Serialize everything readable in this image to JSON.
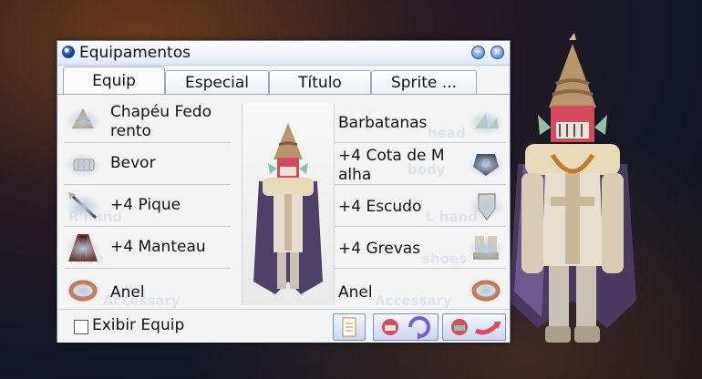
{
  "window": {
    "title": "Equipamentos",
    "minimize_label": "−",
    "close_label": "×",
    "tabs": [
      {
        "label": "Equip",
        "active": true
      },
      {
        "label": "Especial",
        "active": false
      },
      {
        "label": "Título",
        "active": false
      },
      {
        "label": "Sprite ...",
        "active": false
      }
    ]
  },
  "left_slots": [
    {
      "name": "Chapéu Fedo\nrento",
      "ghost": "",
      "icon": "hat-icon"
    },
    {
      "name": "Bevor",
      "ghost": "",
      "icon": "mask-icon"
    },
    {
      "name": "+4 Pique",
      "ghost": "R hand",
      "icon": "spear-icon"
    },
    {
      "name": "+4 Manteau",
      "ghost": "robe",
      "icon": "manteau-icon"
    },
    {
      "name": "Anel",
      "ghost": "Accessary",
      "icon": "ring-icon"
    }
  ],
  "right_slots": [
    {
      "name": "Barbatanas",
      "ghost": "head",
      "icon": "fins-icon"
    },
    {
      "name": "+4 Cota de M\nalha",
      "ghost": "body",
      "icon": "chainmail-icon"
    },
    {
      "name": "+4 Escudo",
      "ghost": "L hand",
      "icon": "shield-icon"
    },
    {
      "name": "+4 Grevas",
      "ghost": "shoes",
      "icon": "greaves-icon"
    },
    {
      "name": "Anel",
      "ghost": "Accessary",
      "icon": "ring-icon"
    }
  ],
  "bottom": {
    "show_equip_label": "Exibir Equip",
    "show_equip_checked": false
  },
  "colors": {
    "window_bg": "#f4f4f4",
    "title_bar": "#dfe8f5",
    "accent_blue": "#3c6fd0",
    "background": "#151826"
  }
}
